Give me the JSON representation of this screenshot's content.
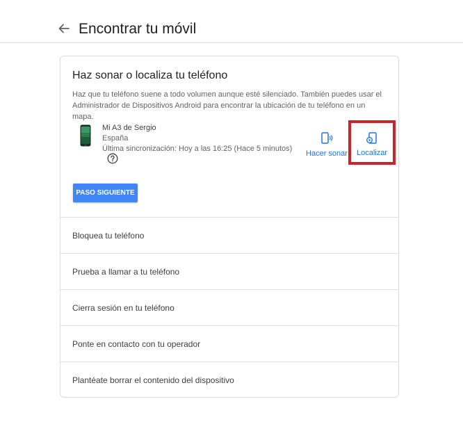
{
  "header": {
    "title": "Encontrar tu móvil"
  },
  "section": {
    "title": "Haz sonar o localiza tu teléfono",
    "description": "Haz que tu teléfono suene a todo volumen aunque esté silenciado. También puedes usar el Administrador de Dispositivos Android para encontrar la ubicación de tu teléfono en un mapa."
  },
  "device": {
    "name": "Mi A3 de Sergio",
    "country": "España",
    "last_sync": "Última sincronización: Hoy a las 16:25 (Hace 5 minutos)"
  },
  "actions": {
    "ring_label": "Hacer sonar",
    "locate_label": "Localizar"
  },
  "next_button": "PASO SIGUIENTE",
  "options": [
    {
      "label": "Bloquea tu teléfono"
    },
    {
      "label": "Prueba a llamar a tu teléfono"
    },
    {
      "label": "Cierra sesión en tu teléfono"
    },
    {
      "label": "Ponte en contacto con tu operador"
    },
    {
      "label": "Plantéate borrar el contenido del dispositivo"
    }
  ],
  "colors": {
    "accent": "#1a73e8",
    "button": "#4285f4",
    "highlight_box": "#c5262d"
  },
  "icons": {
    "back": "arrow-back-icon",
    "help": "help-circle-icon",
    "ring": "phone-ring-icon",
    "locate": "phone-locate-icon"
  }
}
